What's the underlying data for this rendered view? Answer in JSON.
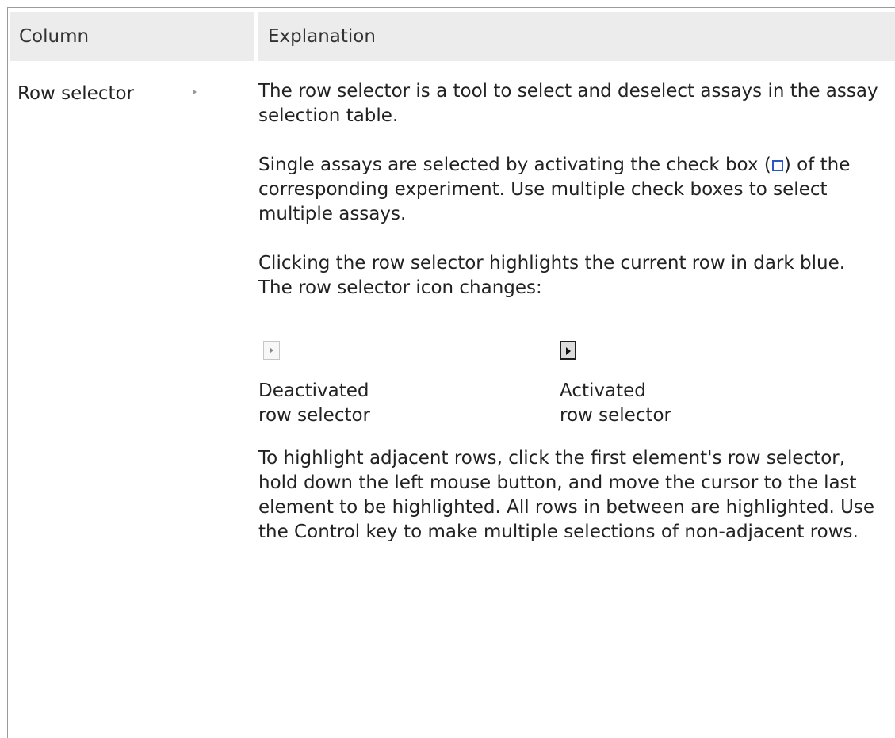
{
  "table": {
    "headers": {
      "column": "Column",
      "explanation": "Explanation"
    },
    "rows": [
      {
        "column_label": "Row selector",
        "paragraphs": {
          "p1": "The row selector is a tool to select and deselect assays in the assay selection table.",
          "p2_before": "Single assays are selected by activating the check box (",
          "p2_after": ") of the corresponding experiment. Use multiple check boxes to select multiple assays.",
          "p3": "Clicking the row selector highlights the current row in dark blue. The row selector icon changes:",
          "p4": "To highlight adjacent rows, click the first element's row selector, hold down the left mouse button, and move the cursor to the last element to be highlighted. All rows in between are highlighted. Use the Control key to make multiple selections of non-adjacent rows."
        },
        "icon_captions": {
          "deactivated_line1": "Deactivated",
          "deactivated_line2": "row selector",
          "activated_line1": "Activated",
          "activated_line2": "row selector"
        }
      }
    ]
  },
  "icons": {
    "row_selector": "row-selector-icon",
    "checkbox": "checkbox-icon"
  },
  "colors": {
    "header_bg": "#ececec",
    "checkbox_border": "#2a56c6",
    "text": "#222222"
  }
}
